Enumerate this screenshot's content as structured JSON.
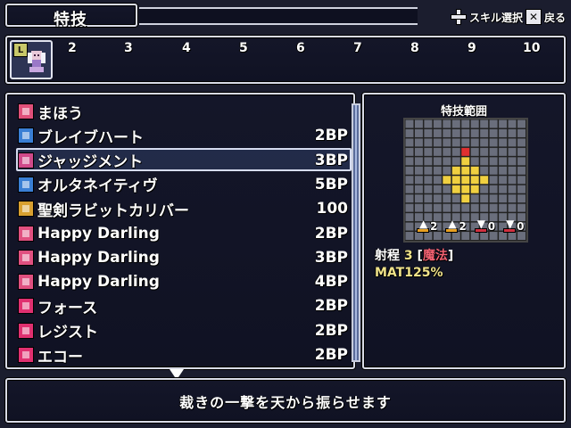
{
  "header": {
    "title": "特技",
    "hints": [
      {
        "key_icon": "dpad-icon",
        "label": "スキル選択"
      },
      {
        "key_icon": "x-button-icon",
        "label": "戻る"
      }
    ]
  },
  "party": {
    "selected_slot_badge": "L",
    "slots": [
      "2",
      "3",
      "4",
      "5",
      "6",
      "7",
      "8",
      "9",
      "10"
    ]
  },
  "skills": [
    {
      "icon": "magic-category-icon",
      "name": "まほう",
      "cost": "",
      "icon_color": "#e0507a"
    },
    {
      "icon": "blue-gem-icon",
      "name": "ブレイブハート",
      "cost": "2BP",
      "icon_color": "#3a7fd4"
    },
    {
      "icon": "pink-gem-icon",
      "name": "ジャッジメント",
      "cost": "3BP",
      "icon_color": "#d04a8a"
    },
    {
      "icon": "blue-gem-icon",
      "name": "オルタネイティヴ",
      "cost": "5BP",
      "icon_color": "#3a7fd4"
    },
    {
      "icon": "gold-sword-icon",
      "name": "聖剣ラビットカリバー",
      "cost": "100",
      "icon_color": "#d8a030"
    },
    {
      "icon": "music-note-icon",
      "name": "Happy Darling",
      "cost": "2BP",
      "icon_color": "#e05080"
    },
    {
      "icon": "music-note-plus-icon",
      "name": "Happy Darling",
      "cost": "3BP",
      "icon_color": "#e05080"
    },
    {
      "icon": "music-note-plus2-icon",
      "name": "Happy Darling",
      "cost": "4BP",
      "icon_color": "#e05080"
    },
    {
      "icon": "vo-icon",
      "name": "フォース",
      "cost": "2BP",
      "icon_color": "#e03070"
    },
    {
      "icon": "vo-icon",
      "name": "レジスト",
      "cost": "2BP",
      "icon_color": "#e03070"
    },
    {
      "icon": "vo-icon",
      "name": "エコー",
      "cost": "2BP",
      "icon_color": "#e03070"
    }
  ],
  "selected_index": 2,
  "range_panel": {
    "title": "特技範囲",
    "grid_size": 13,
    "origin": [
      6,
      3
    ],
    "cells": [
      [
        6,
        3
      ],
      [
        6,
        4
      ],
      [
        5,
        5
      ],
      [
        6,
        5
      ],
      [
        7,
        5
      ],
      [
        4,
        6
      ],
      [
        5,
        6
      ],
      [
        6,
        6
      ],
      [
        7,
        6
      ],
      [
        8,
        6
      ],
      [
        5,
        7
      ],
      [
        6,
        7
      ],
      [
        7,
        7
      ],
      [
        6,
        8
      ]
    ],
    "origin_color": "#e03030",
    "cell_color": "#f0d040",
    "stat_mods": [
      {
        "icon": "atk-up-icon",
        "value": "2"
      },
      {
        "icon": "def-up-icon",
        "value": "2"
      },
      {
        "icon": "atk-down-icon",
        "value": "0"
      },
      {
        "icon": "def-down-icon",
        "value": "0"
      }
    ],
    "range_label": "射程",
    "range_value": "3",
    "range_type_open": "[",
    "range_type": "魔法",
    "range_type_close": "]",
    "mat": "MAT125%"
  },
  "description": "裁きの一撃を天から振らせます"
}
